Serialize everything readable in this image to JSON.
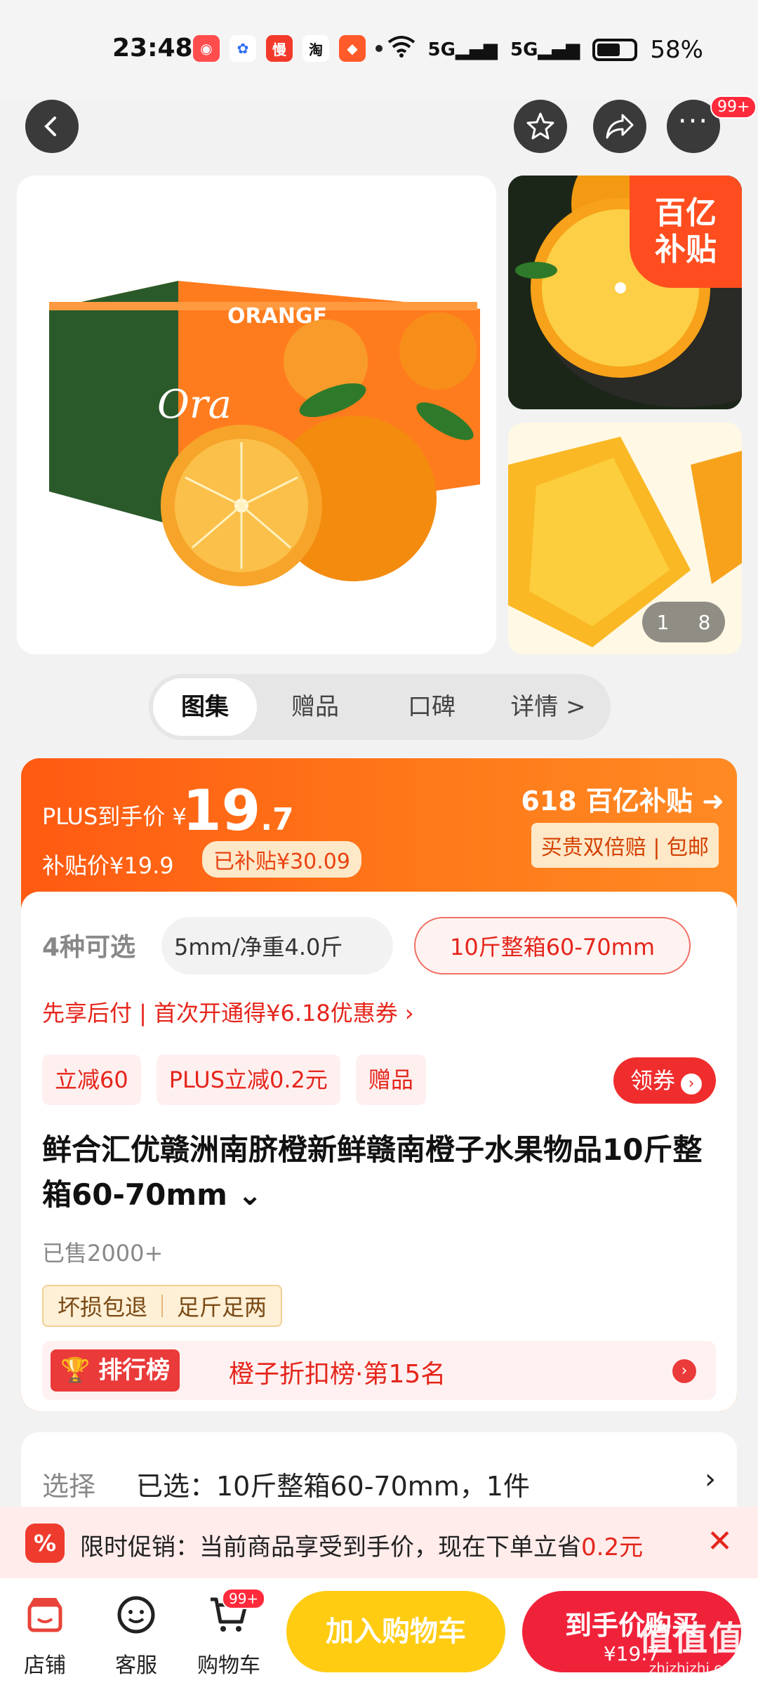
{
  "status": {
    "time": "23:48",
    "battery": "58%",
    "signal1": "5G",
    "signal2": "5G"
  },
  "nav": {
    "more_badge": "99+"
  },
  "gallery": {
    "subsidy_badge_line1": "百亿",
    "subsidy_badge_line2": "补贴",
    "pager_current": "1",
    "pager_total": "8"
  },
  "tabs": [
    "图集",
    "赠品",
    "口碑",
    "详情 >"
  ],
  "price": {
    "plus_label": "PLUS到手价 ¥",
    "price_int": "19",
    "price_dec": ".7",
    "subsidy_price": "补贴价¥19.9",
    "subsidy_tag": "已补贴¥30.09",
    "logo": "618 百亿补贴",
    "guarantee": "买贵双倍赔 | 包邮"
  },
  "options": {
    "count": "4种可选",
    "option1": "5mm/净重4.0斤",
    "option2": "10斤整箱60-70mm"
  },
  "promo_line": "先享后付 | 首次开通得¥6.18优惠券 ›",
  "chips": [
    "立减60",
    "PLUS立减0.2元",
    "赠品"
  ],
  "coupon": "领券",
  "product_title": "鲜合汇优赣洲南脐橙新鲜赣南橙子水果物品10斤整箱60-70mm ⌄",
  "sold": "已售2000+",
  "guarantees": [
    "坏损包退",
    "足斤足两"
  ],
  "rank": {
    "tag": "排行榜",
    "text": "橙子折扣榜·第15名"
  },
  "select": {
    "label": "选择",
    "value": "已选：10斤整箱60-70mm，1件"
  },
  "promo_bar": {
    "text": "限时促销：当前商品享受到手价，现在下单立省",
    "amount": "0.2元"
  },
  "bottom": {
    "shop": "店铺",
    "service": "客服",
    "cart": "购物车",
    "cart_badge": "99+",
    "add_cart": "加入购物车",
    "buy": "到手价购买",
    "buy_price": "¥19.7",
    "watermark": "值值值",
    "watermark_url": "zhizhizhi.com"
  },
  "colors": {
    "accent_red": "#e5251b",
    "orange": "#ff6a14",
    "yellow_btn": "#ffcc12"
  }
}
